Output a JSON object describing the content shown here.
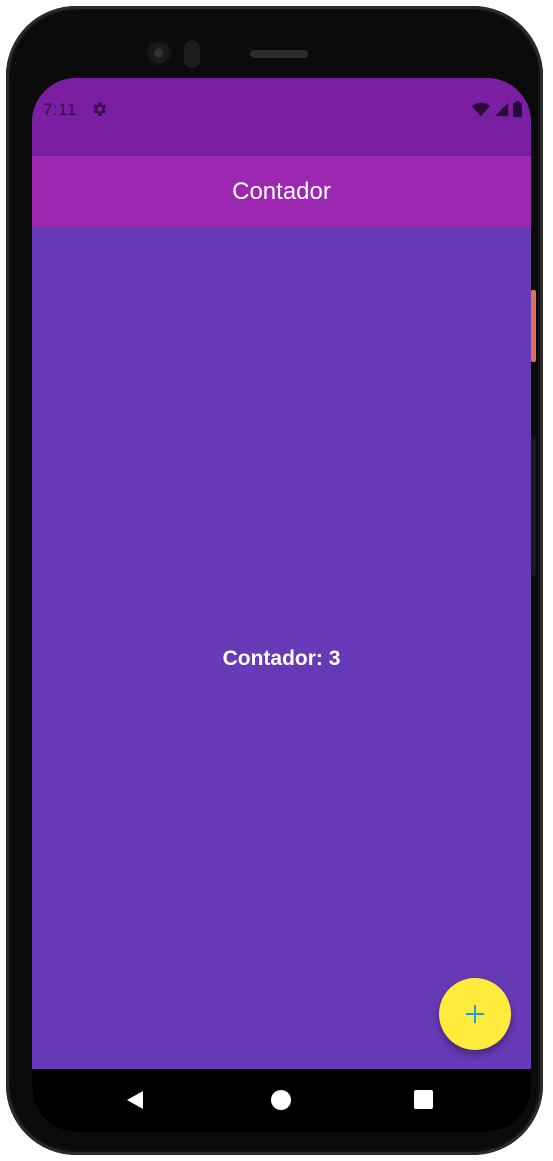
{
  "status_bar": {
    "time": "7:11",
    "icons": [
      "settings-icon",
      "wifi-icon",
      "cellular-signal-icon",
      "battery-icon"
    ]
  },
  "app_bar": {
    "title": "Contador"
  },
  "main": {
    "counter_label": "Contador: 3"
  },
  "fab": {
    "icon": "plus-icon"
  },
  "navigation_bar": {
    "buttons": [
      "back-icon",
      "home-icon",
      "recents-icon"
    ]
  },
  "colors": {
    "status_bar": "#7b1fa2",
    "app_bar": "#9c27b0",
    "background": "#673ab7",
    "fab": "#ffeb3b",
    "fab_icon": "#2196f3",
    "nav_bar": "#000000"
  }
}
